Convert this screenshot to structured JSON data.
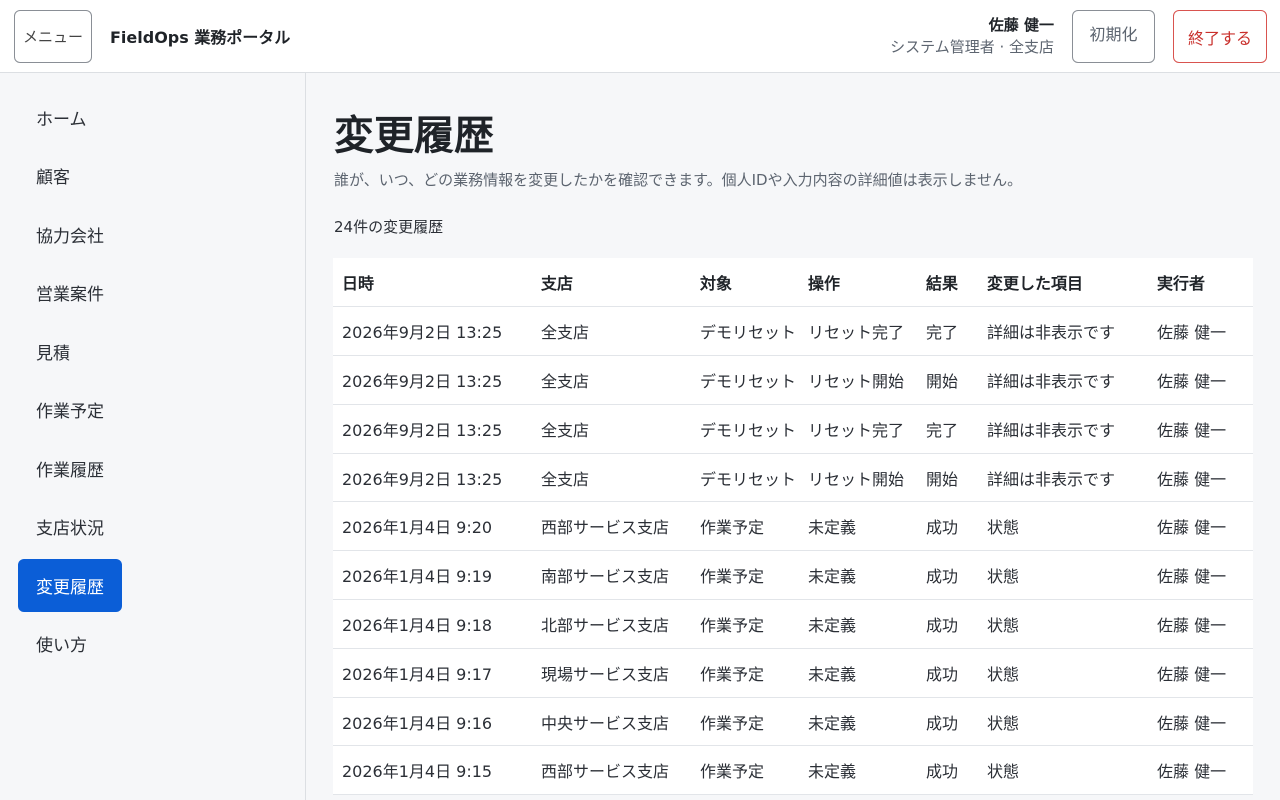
{
  "header": {
    "menu_label": "メニュー",
    "brand": "FieldOps 業務ポータル",
    "user_name": "佐藤 健一",
    "user_role": "システム管理者 · 全支店",
    "reset_label": "初期化",
    "end_label": "終了する"
  },
  "sidebar": {
    "items": [
      {
        "label": "ホーム"
      },
      {
        "label": "顧客"
      },
      {
        "label": "協力会社"
      },
      {
        "label": "営業案件"
      },
      {
        "label": "見積"
      },
      {
        "label": "作業予定"
      },
      {
        "label": "作業履歴"
      },
      {
        "label": "支店状況"
      },
      {
        "label": "変更履歴",
        "active": true
      },
      {
        "label": "使い方"
      }
    ]
  },
  "main": {
    "title": "変更履歴",
    "description": "誰が、いつ、どの業務情報を変更したかを確認できます。個人IDや入力内容の詳細値は表示しません。",
    "count_text": "24件の変更履歴",
    "table": {
      "headers": [
        "日時",
        "支店",
        "対象",
        "操作",
        "結果",
        "変更した項目",
        "実行者"
      ],
      "rows": [
        [
          "2026年9月2日 13:25",
          "全支店",
          "デモリセット",
          "リセット完了",
          "完了",
          "詳細は非表示です",
          "佐藤 健一"
        ],
        [
          "2026年9月2日 13:25",
          "全支店",
          "デモリセット",
          "リセット開始",
          "開始",
          "詳細は非表示です",
          "佐藤 健一"
        ],
        [
          "2026年9月2日 13:25",
          "全支店",
          "デモリセット",
          "リセット完了",
          "完了",
          "詳細は非表示です",
          "佐藤 健一"
        ],
        [
          "2026年9月2日 13:25",
          "全支店",
          "デモリセット",
          "リセット開始",
          "開始",
          "詳細は非表示です",
          "佐藤 健一"
        ],
        [
          "2026年1月4日 9:20",
          "西部サービス支店",
          "作業予定",
          "未定義",
          "成功",
          "状態",
          "佐藤 健一"
        ],
        [
          "2026年1月4日 9:19",
          "南部サービス支店",
          "作業予定",
          "未定義",
          "成功",
          "状態",
          "佐藤 健一"
        ],
        [
          "2026年1月4日 9:18",
          "北部サービス支店",
          "作業予定",
          "未定義",
          "成功",
          "状態",
          "佐藤 健一"
        ],
        [
          "2026年1月4日 9:17",
          "現場サービス支店",
          "作業予定",
          "未定義",
          "成功",
          "状態",
          "佐藤 健一"
        ],
        [
          "2026年1月4日 9:16",
          "中央サービス支店",
          "作業予定",
          "未定義",
          "成功",
          "状態",
          "佐藤 健一"
        ],
        [
          "2026年1月4日 9:15",
          "西部サービス支店",
          "作業予定",
          "未定義",
          "成功",
          "状態",
          "佐藤 健一"
        ]
      ]
    }
  }
}
